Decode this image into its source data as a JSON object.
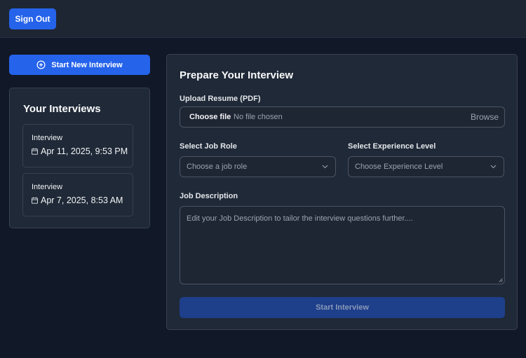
{
  "header": {
    "sign_out_label": "Sign Out"
  },
  "sidebar": {
    "new_interview_label": "Start New Interview",
    "title": "Your Interviews",
    "interviews": [
      {
        "label": "Interview",
        "date": "Apr 11, 2025, 9:53 PM"
      },
      {
        "label": "Interview",
        "date": "Apr 7, 2025, 8:53 AM"
      }
    ]
  },
  "form": {
    "title": "Prepare Your Interview",
    "resume": {
      "label": "Upload Resume (PDF)",
      "choose_label": "Choose file",
      "status": "No file chosen",
      "browse_label": "Browse"
    },
    "job_role": {
      "label": "Select Job Role",
      "placeholder": "Choose a job role"
    },
    "experience": {
      "label": "Select Experience Level",
      "placeholder": "Choose Experience Level"
    },
    "description": {
      "label": "Job Description",
      "placeholder": "Edit your Job Description to tailor the interview questions further...."
    },
    "submit_label": "Start Interview"
  },
  "colors": {
    "accent": "#2563eb",
    "accent_disabled": "#1e3f8a",
    "background": "#111827",
    "panel": "#1f2937"
  },
  "icons": {
    "new_interview": "plus-circle-icon",
    "date": "calendar-icon",
    "select": "chevron-down-icon"
  }
}
